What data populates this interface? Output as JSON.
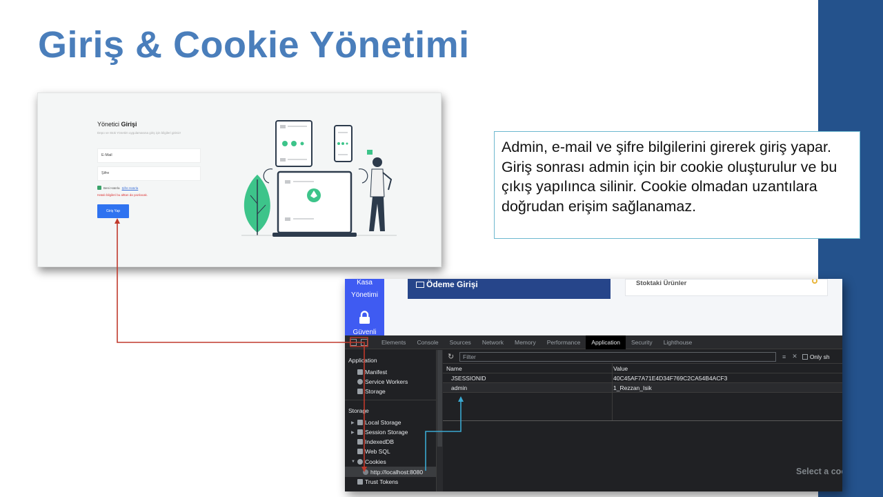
{
  "slide": {
    "title": "Giriş & Cookie Yönetimi",
    "accent_color": "#24528c",
    "title_color": "#4a7ebb"
  },
  "login_screenshot": {
    "heading_prefix": "Yönetici ",
    "heading_bold": "Girişi",
    "subtitle": "Depo ve Stok Yönetim uygulamasına giriş için bilgileri giriniz!",
    "email_placeholder": "E-Mail",
    "password_placeholder": "Şifre",
    "remember_text": "Beni Hatırla",
    "forgot_link": "Şifre Hatırla",
    "error_text": "Hatalı bilgileri bu alttan da yazılacak.",
    "login_button": "Giriş Yap",
    "button_color": "#2f73f0"
  },
  "callout": {
    "text": "Admin, e-mail ve şifre bilgilerini girerek giriş yapar. Giriş sonrası admin için bir cookie oluşturulur ve bu çıkış yapılınca silinir. Cookie olmadan uzantılara doğrudan erişim sağlanamaz."
  },
  "app_strip": {
    "sidebar_kasa": "Kasa",
    "sidebar_yonetimi": "Yönetimi",
    "sidebar_guvenli": "Güvenli",
    "odeme_title": "Ödeme Girişi",
    "stok_title": "Stoktaki Ürünler"
  },
  "devtools": {
    "tabs": [
      {
        "label": "Elements",
        "active": false
      },
      {
        "label": "Console",
        "active": false
      },
      {
        "label": "Sources",
        "active": false
      },
      {
        "label": "Network",
        "active": false
      },
      {
        "label": "Memory",
        "active": false
      },
      {
        "label": "Performance",
        "active": false
      },
      {
        "label": "Application",
        "active": true
      },
      {
        "label": "Security",
        "active": false
      },
      {
        "label": "Lighthouse",
        "active": false
      }
    ],
    "sidebar": {
      "application_header": "Application",
      "application_items": [
        "Manifest",
        "Service Workers",
        "Storage"
      ],
      "storage_header": "Storage",
      "storage_items": [
        "Local Storage",
        "Session Storage",
        "IndexedDB",
        "Web SQL",
        "Cookies"
      ],
      "cookie_origin": "http://localhost:8080",
      "trust_tokens": "Trust Tokens"
    },
    "filter_placeholder": "Filter",
    "only_show_label": "Only sh",
    "table": {
      "headers": [
        "Name",
        "Value"
      ],
      "rows": [
        {
          "name": "JSESSIONID",
          "value": "40C45AF7A71E4D34F769C2CA54B4ACF3"
        },
        {
          "name": "admin",
          "value": "1_Rezzan_Isik"
        }
      ]
    },
    "select_cookie_text": "Select a coo"
  },
  "connectors": {
    "red_arrow_color": "#c0392b",
    "blue_arrow_color": "#3aa8d0"
  }
}
